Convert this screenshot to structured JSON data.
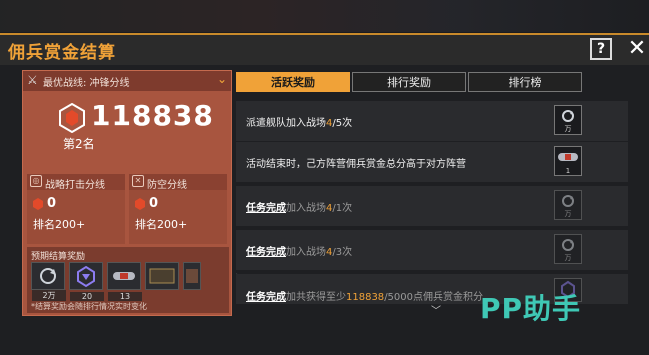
{
  "window": {
    "title": "佣兵赏金结算",
    "help_label": "?",
    "close_label": "✕"
  },
  "left_card": {
    "route_label": "最优战线: 冲锋分线",
    "score": "118838",
    "rank": "第2名",
    "sub_routes": [
      {
        "name": "战略打击分线",
        "score": "0",
        "rank": "排名200+"
      },
      {
        "name": "防空分线",
        "score": "0",
        "rank": "排名200+"
      }
    ],
    "preview": {
      "header": "预期结算奖励",
      "items": [
        {
          "icon": "refresh-icon",
          "qty": "2万"
        },
        {
          "icon": "badge-icon",
          "qty": "20"
        },
        {
          "icon": "capsule-icon",
          "qty": "13"
        },
        {
          "icon": "card-icon",
          "qty": ""
        },
        {
          "icon": "item-icon",
          "qty": ""
        }
      ],
      "note": "*结算奖励会随排行情况实时变化"
    }
  },
  "tabs": [
    {
      "label": "活跃奖励",
      "active": true
    },
    {
      "label": "排行奖励",
      "active": false
    },
    {
      "label": "排行榜",
      "active": false
    }
  ],
  "tasks": [
    {
      "prefix": "",
      "pre": "派遣舰队加入战场",
      "hl": "4",
      "post": "/5次",
      "reward": "万",
      "done": false
    },
    {
      "prefix": "",
      "pre": "活动结束时，己方阵营佣兵赏金总分高于对方阵营",
      "hl": "",
      "post": "",
      "reward": "1",
      "done": false
    },
    {
      "prefix": "任务完成",
      "pre": "加入战场",
      "hl": "4",
      "post": "/1次",
      "reward": "万",
      "done": true
    },
    {
      "prefix": "任务完成",
      "pre": "加入战场",
      "hl": "4",
      "post": "/3次",
      "reward": "万",
      "done": true
    },
    {
      "prefix": "任务完成",
      "pre": "加共获得至少",
      "hl": "118838",
      "post": "/5000点佣兵赏金积分",
      "reward": "",
      "done": true
    }
  ],
  "watermark": "PP助手",
  "colors": {
    "accent": "#f0a238",
    "card": "#a8553f",
    "watermark": "#3fc8b5"
  }
}
